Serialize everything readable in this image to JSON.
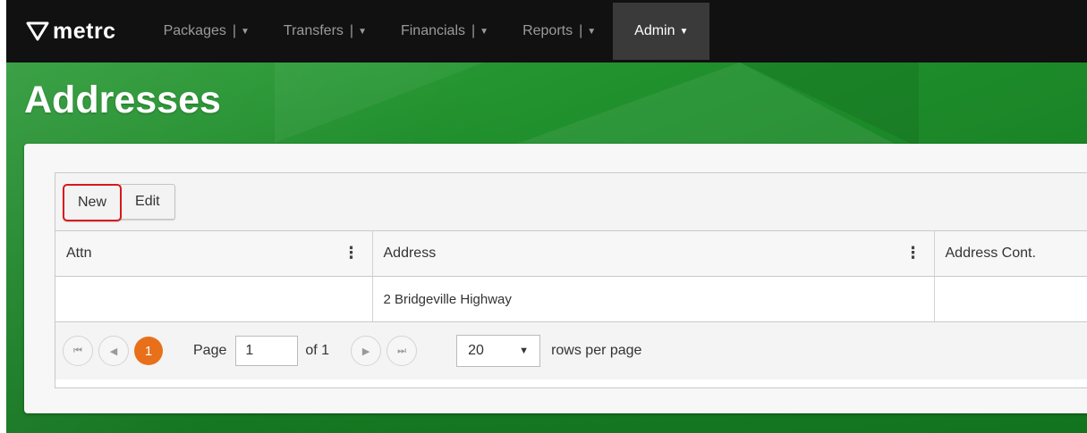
{
  "brand": {
    "logo_text": "metrc",
    "logo_icon": "metrc-triangle-icon"
  },
  "nav": {
    "items": [
      {
        "label": "Packages",
        "sep": "|",
        "active": false
      },
      {
        "label": "Transfers",
        "sep": "|",
        "active": false
      },
      {
        "label": "Financials",
        "sep": "|",
        "active": false
      },
      {
        "label": "Reports",
        "sep": "|",
        "active": false
      },
      {
        "label": "Admin",
        "sep": "",
        "active": true
      }
    ],
    "caret": "▼"
  },
  "page": {
    "title": "Addresses"
  },
  "toolbar": {
    "new_label": "New",
    "edit_label": "Edit",
    "highlight_color": "#d9171c"
  },
  "grid": {
    "columns": [
      "Attn",
      "Address",
      "Address Cont."
    ],
    "rows": [
      [
        "",
        "2 Bridgeville Highway",
        ""
      ]
    ]
  },
  "pager": {
    "first_icon": "⏮",
    "prev_icon": "◀",
    "current_page": "1",
    "page_label": "Page",
    "page_value": "1",
    "of_label": "of 1",
    "next_icon": "▶",
    "last_icon": "⏭",
    "rows_value": "20",
    "rows_caret": "▼",
    "rows_label": "rows per page"
  },
  "colors": {
    "navbar": "#111111",
    "background_green": "#1e8d2b",
    "current_page": "#e8701a"
  }
}
